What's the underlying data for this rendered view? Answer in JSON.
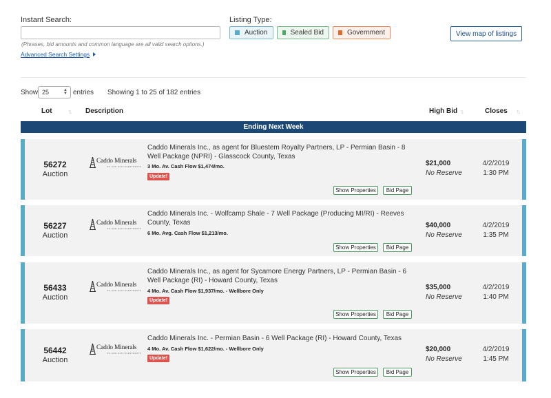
{
  "search": {
    "label": "Instant Search:",
    "value": "",
    "placeholder": "",
    "hint": "(Phrases, bid amounts and common language are all valid search options.)",
    "advanced_link": "Advanced Search Settings"
  },
  "listing_type": {
    "label": "Listing Type:",
    "options": [
      "Auction",
      "Sealed Bid",
      "Government"
    ],
    "colors": {
      "auction": "#5aaac9",
      "sealed_bid": "#4faa6a",
      "government": "#e26a2c"
    }
  },
  "map_button": "View map of listings",
  "entries": {
    "show_label": "Show",
    "page_size": "25",
    "entries_label": "entries",
    "info": "Showing 1 to 25 of 182 entries"
  },
  "table": {
    "headers": {
      "lot": "Lot",
      "description": "Description",
      "high_bid": "High Bid",
      "closes": "Closes"
    },
    "section": "Ending Next Week",
    "logo_text": "Caddo Minerals",
    "logo_sub": "OIL AND GAS INVESTMENTS",
    "show_properties": "Show Properties",
    "bid_page": "Bid Page",
    "update_label": "Update!",
    "rows": [
      {
        "lot": "56272",
        "type": "Auction",
        "description": "Caddo Minerals Inc., as agent for Bluestem Royalty Partners, LP - Permian Basin - 8 Well Package (NPRI) - Glasscock County, Texas",
        "cash_flow": "3 Mo. Av. Cash Flow $1,474/mo.",
        "high_bid": "$21,000",
        "reserve": "No Reserve",
        "close_date": "4/2/2019",
        "close_time": "1:30 PM"
      },
      {
        "lot": "56227",
        "type": "Auction",
        "description": "Caddo Minerals Inc. - Wolfcamp Shale - 7 Well Package (Producing MI/RI) - Reeves County, Texas",
        "cash_flow": "6 Mo. Avg. Cash Flow $1,213/mo.",
        "high_bid": "$40,000",
        "reserve": "No Reserve",
        "close_date": "4/2/2019",
        "close_time": "1:35 PM"
      },
      {
        "lot": "56433",
        "type": "Auction",
        "description": "Caddo Minerals Inc., as agent for Sycamore Energy Partners, LP - Permian Basin - 6 Well Package (RI) - Howard County, Texas",
        "cash_flow": "4 Mo. Av. Cash Flow $1,937/mo. - Wellbore Only",
        "high_bid": "$35,000",
        "reserve": "No Reserve",
        "close_date": "4/2/2019",
        "close_time": "1:40 PM"
      },
      {
        "lot": "56442",
        "type": "Auction",
        "description": "Caddo Minerals Inc. - Permian Basin - 6 Well Package (RI) - Howard County, Texas",
        "cash_flow": "4 Mo. Av. Cash Flow $1,622/mo. - Wellbore Only",
        "high_bid": "$20,000",
        "reserve": "No Reserve",
        "close_date": "4/2/2019",
        "close_time": "1:45 PM"
      }
    ]
  }
}
